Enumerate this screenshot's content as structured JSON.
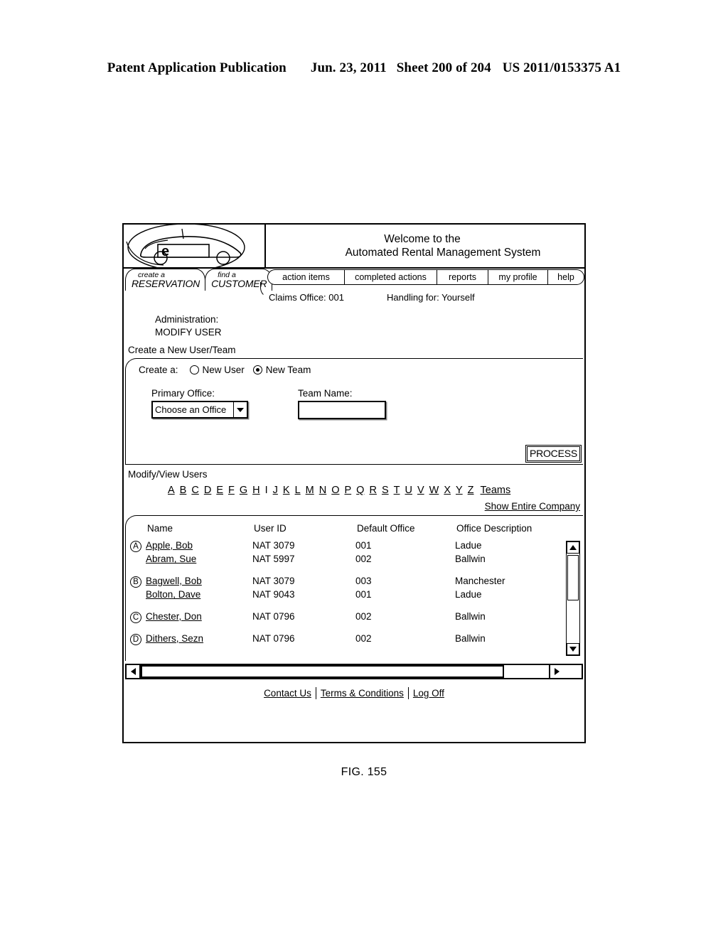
{
  "patent_header": {
    "title": "Patent Application Publication",
    "date": "Jun. 23, 2011",
    "sheet": "Sheet 200 of 204",
    "number": "US 2011/0153375 A1"
  },
  "figure": {
    "caption": "FIG. 155"
  },
  "banner": {
    "logo_letter": "e",
    "welcome_line1": "Welcome to the",
    "welcome_line2": "Automated Rental Management System"
  },
  "left_tabs": [
    {
      "small": "create a",
      "big": "RESERVATION"
    },
    {
      "small": "find a",
      "big": "CUSTOMER"
    }
  ],
  "right_tabs": [
    {
      "label": "action items"
    },
    {
      "label": "completed actions"
    },
    {
      "label": "reports"
    },
    {
      "label": "my profile"
    },
    {
      "label": "help"
    }
  ],
  "context": {
    "claims_office": "Claims Office: 001",
    "handling_for": "Handling for: Yourself"
  },
  "admin": {
    "line1": "Administration:",
    "line2": "MODIFY USER",
    "section_caption": "Create a New User/Team"
  },
  "create_panel": {
    "create_a_label": "Create a:",
    "options": [
      {
        "label": "New User",
        "selected": false
      },
      {
        "label": "New Team",
        "selected": true
      }
    ],
    "primary_office_label": "Primary Office:",
    "primary_office_value": "Choose an Office",
    "team_name_label": "Team Name:",
    "team_name_value": "",
    "process_label": "PROCESS"
  },
  "modify_users": {
    "heading": "Modify/View Users",
    "letters": [
      "A",
      "B",
      "C",
      "D",
      "E",
      "F",
      "G",
      "H",
      "I",
      "J",
      "K",
      "L",
      "M",
      "N",
      "O",
      "P",
      "Q",
      "R",
      "S",
      "T",
      "U",
      "V",
      "W",
      "X",
      "Y",
      "Z"
    ],
    "teams_link": "Teams",
    "show_entire_company": "Show Entire Company"
  },
  "table": {
    "headers": {
      "name": "Name",
      "user_id": "User ID",
      "default_office": "Default Office",
      "office_description": "Office Description"
    },
    "groups": [
      {
        "marker": "A",
        "rows": [
          {
            "name": "Apple, Bob",
            "user_id": "NAT 3079",
            "default_office": "001",
            "office_description": "Ladue"
          },
          {
            "name": "Abram, Sue",
            "user_id": "NAT 5997",
            "default_office": "002",
            "office_description": "Ballwin"
          }
        ]
      },
      {
        "marker": "B",
        "rows": [
          {
            "name": "Bagwell, Bob",
            "user_id": "NAT 3079",
            "default_office": "003",
            "office_description": "Manchester"
          },
          {
            "name": "Bolton, Dave",
            "user_id": "NAT 9043",
            "default_office": "001",
            "office_description": "Ladue"
          }
        ]
      },
      {
        "marker": "C",
        "rows": [
          {
            "name": "Chester, Don",
            "user_id": "NAT 0796",
            "default_office": "002",
            "office_description": "Ballwin"
          }
        ]
      },
      {
        "marker": "D",
        "rows": [
          {
            "name": "Dithers, Sezn",
            "user_id": "NAT 0796",
            "default_office": "002",
            "office_description": "Ballwin"
          }
        ]
      }
    ]
  },
  "footer": {
    "links": [
      "Contact Us",
      "Terms & Conditions",
      "Log Off"
    ]
  }
}
